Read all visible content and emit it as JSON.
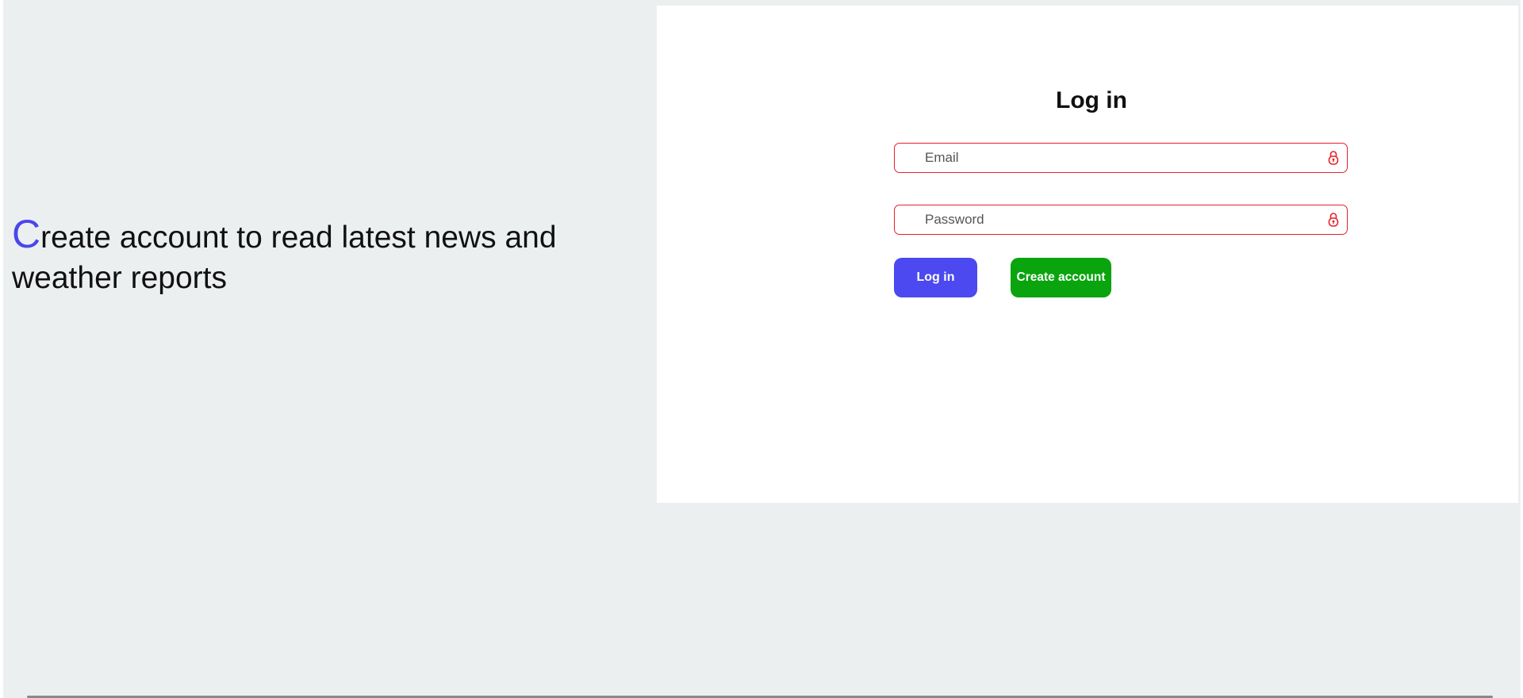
{
  "tagline": {
    "first_letter": "C",
    "rest": "reate account to read latest news and weather reports"
  },
  "login": {
    "title": "Log in",
    "email_placeholder": "Email",
    "email_value": "",
    "password_placeholder": "Password",
    "password_value": "",
    "login_button": "Log in",
    "create_button": "Create account"
  },
  "icons": {
    "field_icon": "lock-icon",
    "field_icon_color": "#e8202a"
  },
  "colors": {
    "accent": "#4a46ec",
    "login_button": "#4b49ef",
    "create_button": "#0aa40f",
    "field_border": "#e8202a",
    "page_background": "#eceff0"
  }
}
